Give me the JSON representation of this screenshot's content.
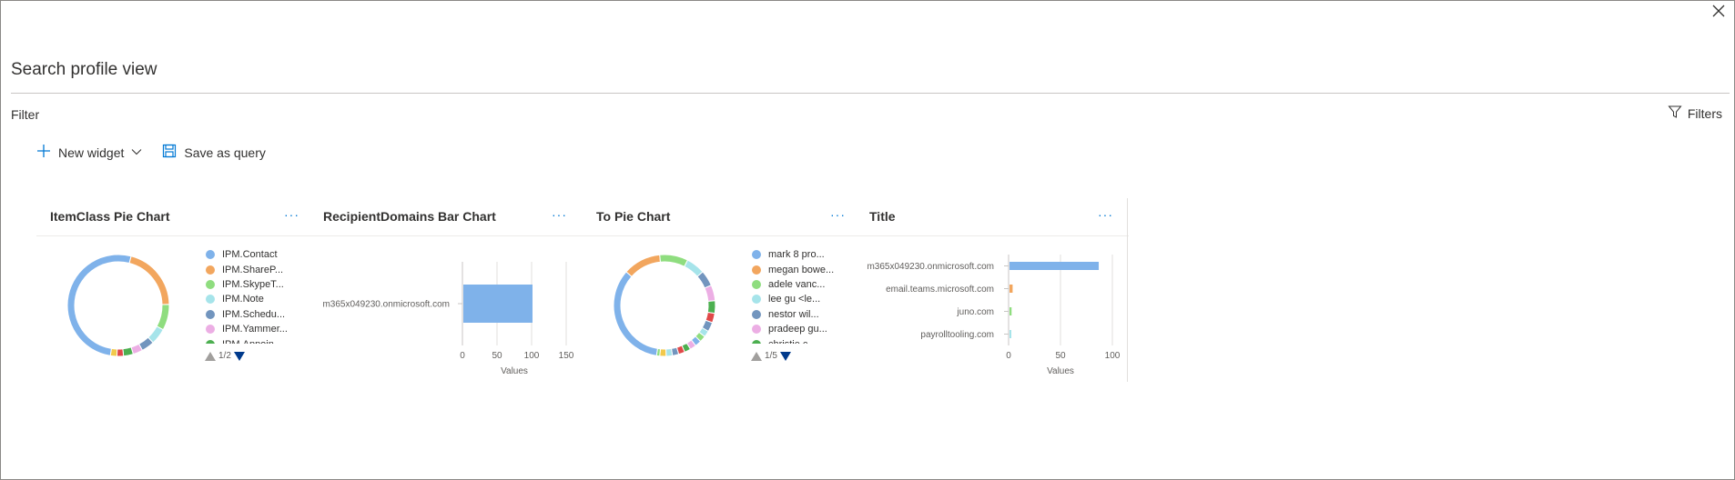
{
  "page": {
    "title": "Search profile view",
    "filter_label": "Filter",
    "filters_button": "Filters",
    "close_icon": "close-icon"
  },
  "toolbar": {
    "new_widget": "New widget",
    "save_as_query": "Save as query"
  },
  "widgets": [
    {
      "title": "ItemClass Pie Chart",
      "more": "···",
      "pager": "1/2"
    },
    {
      "title": "RecipientDomains Bar Chart",
      "more": "···"
    },
    {
      "title": "To Pie Chart",
      "more": "···",
      "pager": "1/5"
    },
    {
      "title": "Title",
      "more": "···"
    }
  ],
  "chart_data": [
    {
      "type": "pie",
      "donut": true,
      "title": "ItemClass Pie Chart",
      "legend_position": "right",
      "labels": [
        "IPM.Contact",
        "IPM.ShareP...",
        "IPM.SkypeT...",
        "IPM.Note",
        "IPM.Schedu...",
        "IPM.Yammer...",
        "IPM.Appoin..."
      ],
      "colors": [
        "#7fb2ea",
        "#f2a65e",
        "#8fdd7f",
        "#a6e4ea",
        "#7295be",
        "#ecaee4",
        "#4caf50"
      ],
      "values": [
        50,
        20,
        8,
        5,
        4,
        3,
        3
      ],
      "extra_slices": [
        {
          "value": 2,
          "color": "#e04848"
        },
        {
          "value": 2,
          "color": "#f2c94c"
        }
      ]
    },
    {
      "type": "bar",
      "orientation": "horizontal",
      "title": "RecipientDomains Bar Chart",
      "categories": [
        "m365x049230.onmicrosoft.com"
      ],
      "values": [
        100
      ],
      "colors": [
        "#7fb2ea"
      ],
      "xlabel": "Values",
      "xlim": [
        0,
        150
      ],
      "xticks": [
        0,
        50,
        100,
        150
      ]
    },
    {
      "type": "pie",
      "donut": true,
      "title": "To Pie Chart",
      "legend_position": "right",
      "labels": [
        "mark 8 pro...",
        "megan bowe...",
        "adele vanc...",
        "lee gu <le...",
        "nestor wil...",
        "pradeep gu...",
        "christie c..."
      ],
      "colors": [
        "#7fb2ea",
        "#f2a65e",
        "#8fdd7f",
        "#a6e4ea",
        "#7295be",
        "#ecaee4",
        "#4caf50"
      ],
      "values": [
        34,
        12,
        9,
        6,
        5,
        5,
        4
      ],
      "extra_slices": [
        {
          "value": 3,
          "color": "#e04848"
        },
        {
          "value": 3,
          "color": "#7295be"
        },
        {
          "value": 2,
          "color": "#a6e4ea"
        },
        {
          "value": 2,
          "color": "#8fdd7f"
        },
        {
          "value": 2,
          "color": "#7fb2ea"
        },
        {
          "value": 2,
          "color": "#ecaee4"
        },
        {
          "value": 2,
          "color": "#4caf50"
        },
        {
          "value": 2,
          "color": "#e04848"
        },
        {
          "value": 2,
          "color": "#7295be"
        },
        {
          "value": 2,
          "color": "#a6e4ea"
        },
        {
          "value": 2,
          "color": "#f2c94c"
        },
        {
          "value": 1,
          "color": "#8fdd7f"
        }
      ]
    },
    {
      "type": "bar",
      "orientation": "horizontal",
      "title": "Title",
      "categories": [
        "m365x049230.onmicrosoft.com",
        "email.teams.microsoft.com",
        "juno.com",
        "payrolltooling.com"
      ],
      "values": [
        86,
        3,
        2,
        1
      ],
      "colors": [
        "#7fb2ea",
        "#f2a65e",
        "#8fdd7f",
        "#a6e4ea"
      ],
      "xlabel": "Values",
      "xlim": [
        0,
        100
      ],
      "xticks": [
        0,
        50,
        100
      ]
    }
  ]
}
